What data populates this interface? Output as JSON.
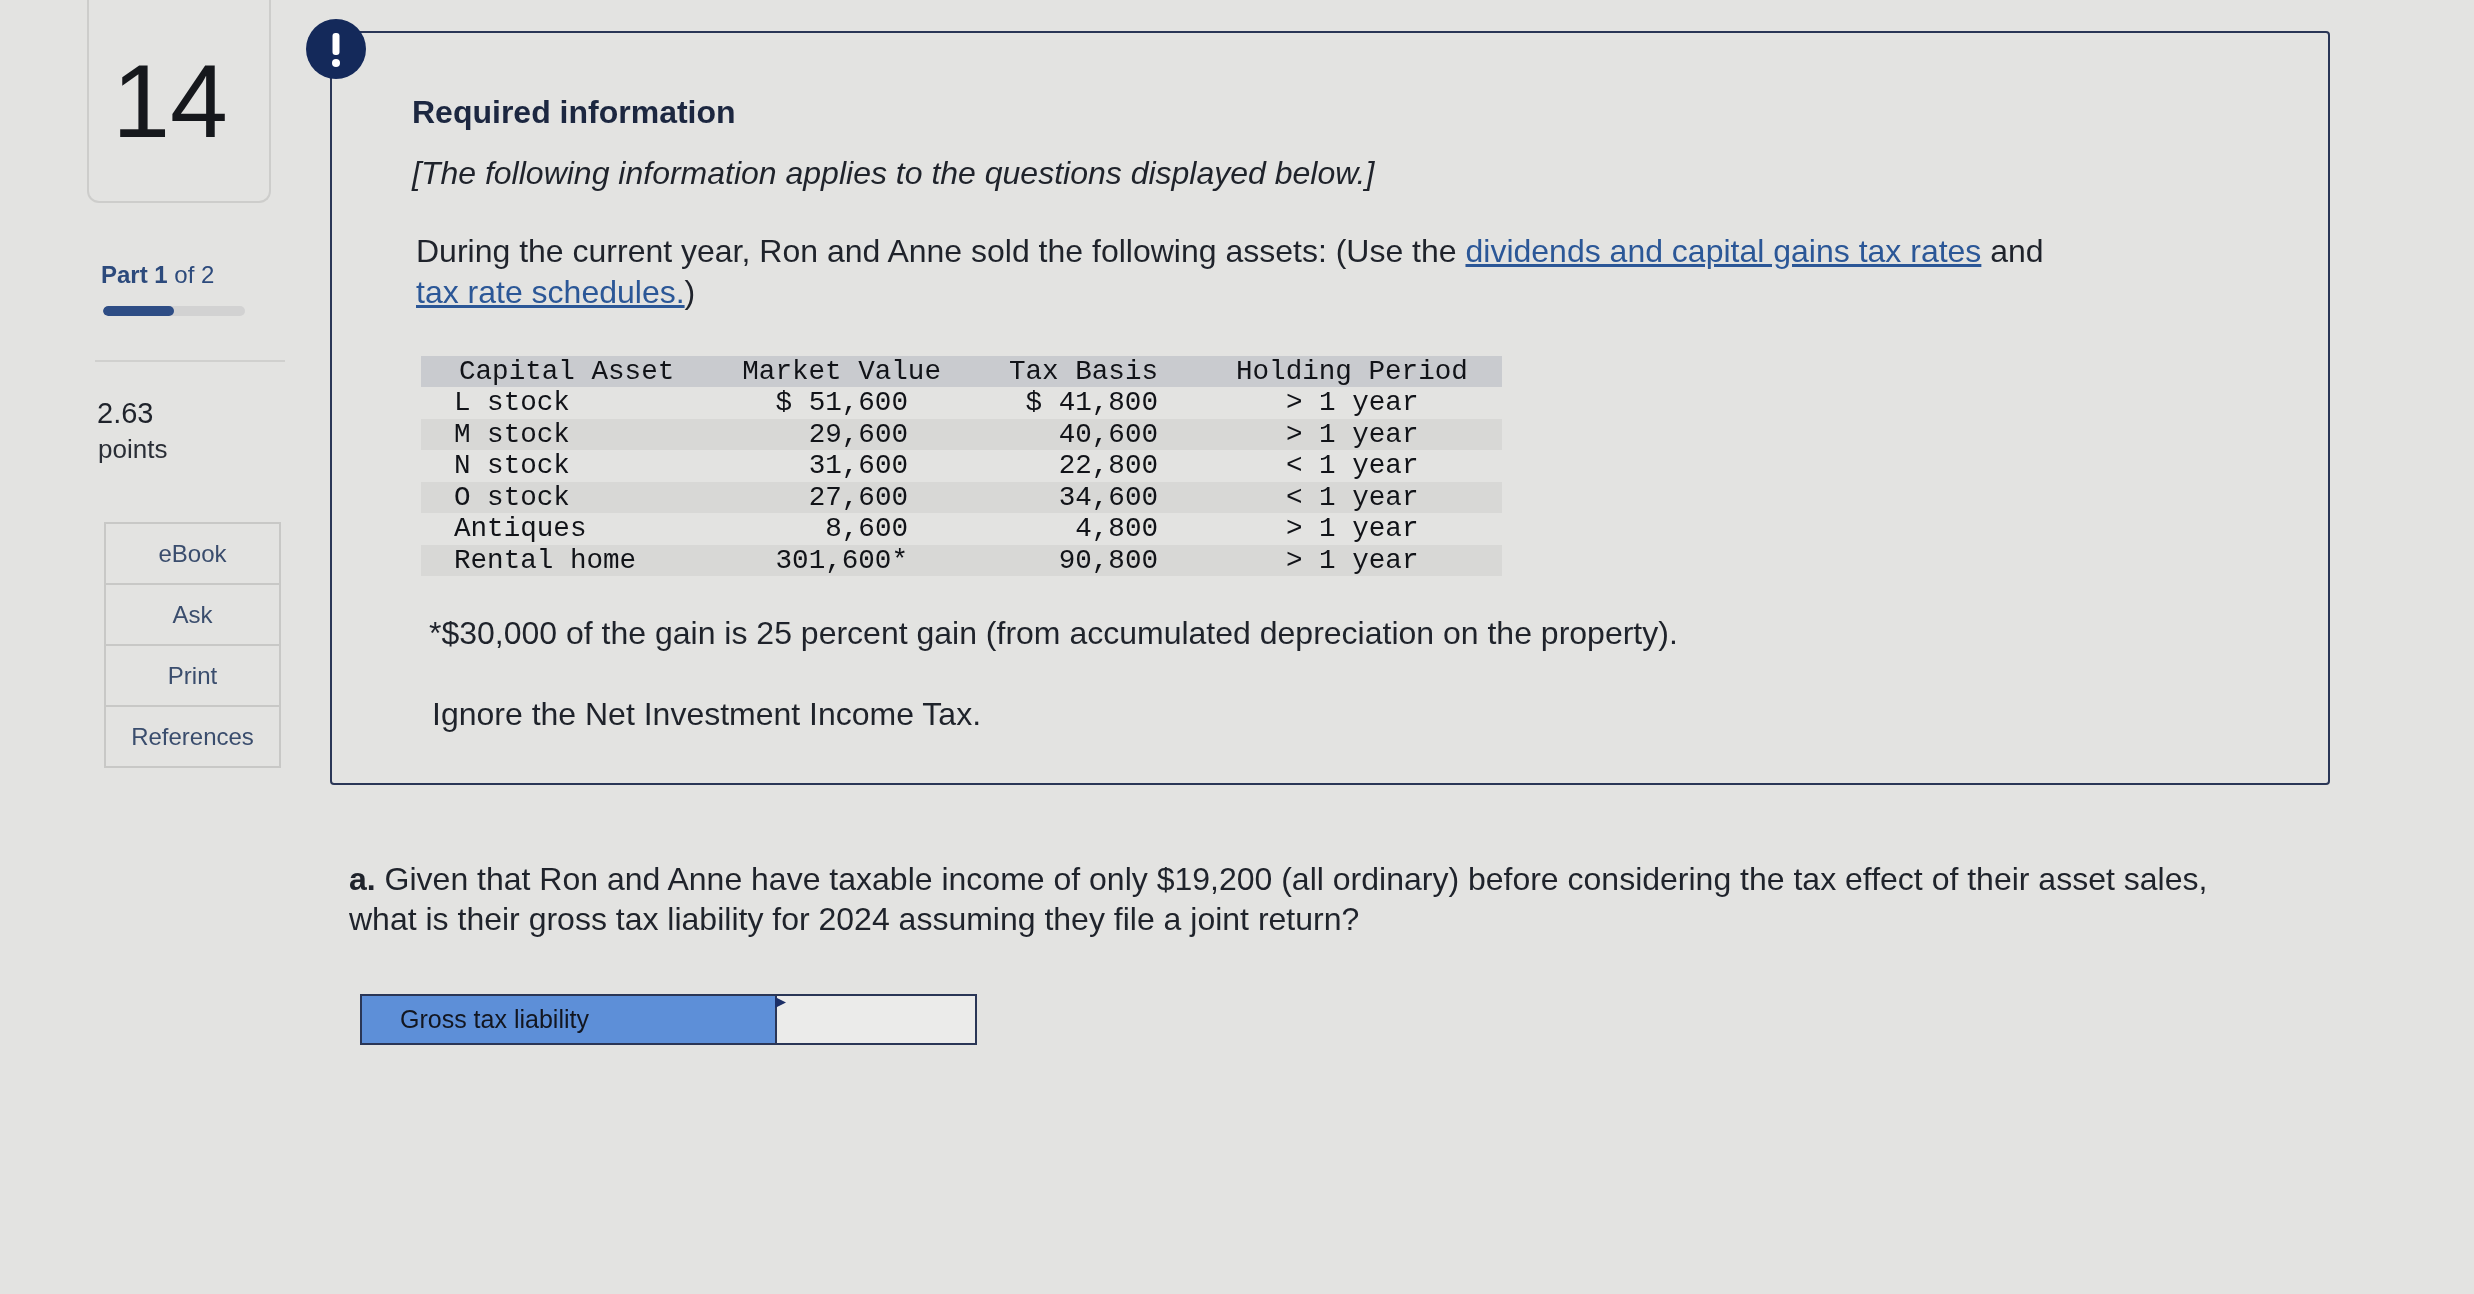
{
  "question_number": "14",
  "part": {
    "label": "**Part 1** of 2",
    "level": 0.5
  },
  "points": {
    "value": "2.63",
    "label": "points"
  },
  "tools": [
    "eBook",
    "Ask",
    "Print",
    "References"
  ],
  "info": {
    "title": "Required information",
    "note": "[The following information applies to the questions displayed below.]",
    "intro": [
      {
        "kind": "text",
        "text": "During the current year, Ron and Anne sold the following assets: (Use the "
      },
      {
        "kind": "link",
        "text": "dividends and capital gains tax rates"
      },
      {
        "kind": "text",
        "text": " and "
      },
      {
        "kind": "link",
        "text": "tax rate schedules."
      },
      {
        "kind": "text",
        "text": ")"
      }
    ],
    "table": {
      "columns": [
        "Capital Asset",
        "Market Value",
        "Tax Basis",
        "Holding Period"
      ],
      "rows": [
        [
          "L stock",
          "$ 51,600",
          "$ 41,800",
          "> 1 year"
        ],
        [
          "M stock",
          "29,600",
          "40,600",
          "> 1 year"
        ],
        [
          "N stock",
          "31,600",
          "22,800",
          "< 1 year"
        ],
        [
          "O stock",
          "27,600",
          "34,600",
          "< 1 year"
        ],
        [
          "Antiques",
          "8,600",
          "4,800",
          "> 1 year"
        ],
        [
          "Rental home",
          "301,600*",
          "90,800",
          "> 1 year"
        ]
      ]
    },
    "footnote": "*$30,000 of the gain is 25 percent gain (from accumulated depreciation on the property).",
    "instruction": "Ignore the Net Investment Income Tax."
  },
  "question": {
    "text": "**a.** Given that Ron and Anne have taxable income of only $19,200 (all ordinary) before considering the tax effect of their asset sales, what is their gross tax liability for 2024 assuming they file a joint return?",
    "answer": {
      "label": "Gross tax liability"
    }
  }
}
